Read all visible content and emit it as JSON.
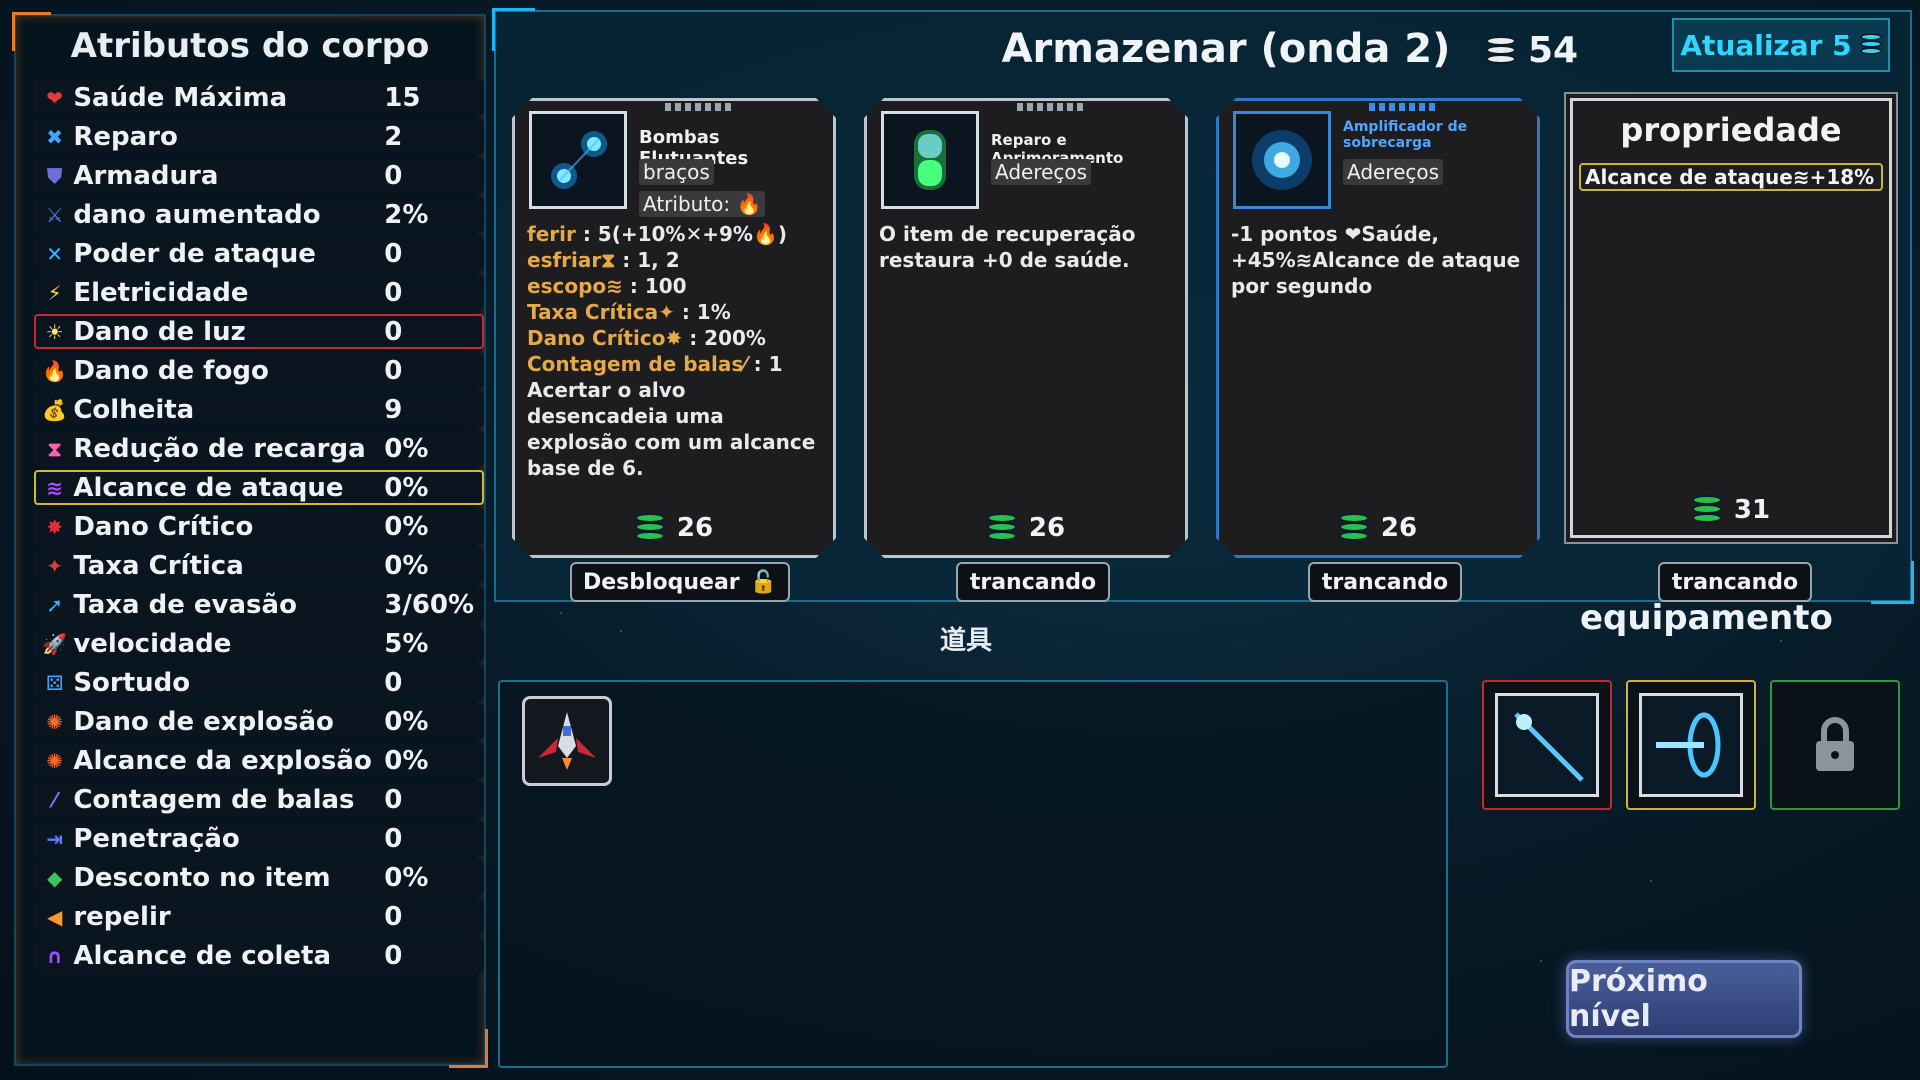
{
  "attributes": {
    "title": "Atributos do corpo",
    "rows": [
      {
        "icon": "heart-icon",
        "glyph": "❤",
        "color": "#e5383b",
        "label": "Saúde Máxima",
        "value": "15"
      },
      {
        "icon": "wrench-icon",
        "glyph": "✖",
        "color": "#3fa7ff",
        "label": "Reparo",
        "value": "2"
      },
      {
        "icon": "shield-icon",
        "glyph": "⛊",
        "color": "#6b6fd6",
        "label": "Armadura",
        "value": "0"
      },
      {
        "icon": "sword-icon",
        "glyph": "⚔",
        "color": "#4a7de0",
        "label": "dano aumentado",
        "value": "2%"
      },
      {
        "icon": "crossed-swords-icon",
        "glyph": "✕",
        "color": "#2fb9ff",
        "label": "Poder de ataque",
        "value": "0"
      },
      {
        "icon": "lightning-icon",
        "glyph": "⚡",
        "color": "#ffd93a",
        "label": "Eletricidade",
        "value": "0"
      },
      {
        "icon": "sun-icon",
        "glyph": "☀",
        "color": "#ffe36a",
        "label": "Dano de luz",
        "value": "0"
      },
      {
        "icon": "fire-icon",
        "glyph": "🔥",
        "color": "#ff8a2a",
        "label": "Dano de fogo",
        "value": "0"
      },
      {
        "icon": "money-bag-icon",
        "glyph": "💰",
        "color": "#4fbf57",
        "label": "Colheita",
        "value": "9"
      },
      {
        "icon": "hourglass-icon",
        "glyph": "⧗",
        "color": "#ff5fb0",
        "label": "Redução de recarga",
        "value": "0%"
      },
      {
        "icon": "wifi-range-icon",
        "glyph": "≋",
        "color": "#b04bff",
        "label": "Alcance de ataque",
        "value": "0%"
      },
      {
        "icon": "critical-damage-icon",
        "glyph": "✸",
        "color": "#e52d36",
        "label": "Dano Crítico",
        "value": "0%"
      },
      {
        "icon": "critical-rate-icon",
        "glyph": "✦",
        "color": "#e5383b",
        "label": "Taxa Crítica",
        "value": "0%"
      },
      {
        "icon": "running-man-icon",
        "glyph": "➚",
        "color": "#36b0ff",
        "label": "Taxa de evasão",
        "value": "3/60%"
      },
      {
        "icon": "rocket-icon",
        "glyph": "🚀",
        "color": "#ff4848",
        "label": "velocidade",
        "value": "5%"
      },
      {
        "icon": "dice-icon",
        "glyph": "⚄",
        "color": "#3aa4ff",
        "label": "Sortudo",
        "value": "0"
      },
      {
        "icon": "explosion-icon",
        "glyph": "✺",
        "color": "#ff6a2a",
        "label": "Dano de explosão",
        "value": "0%"
      },
      {
        "icon": "explosion-range-icon",
        "glyph": "✺",
        "color": "#ff6a2a",
        "label": "Alcance da explosão",
        "value": "0%"
      },
      {
        "icon": "bullet-icon",
        "glyph": "⁄",
        "color": "#8a6cff",
        "label": "Contagem de balas",
        "value": "0"
      },
      {
        "icon": "penetration-icon",
        "glyph": "⇥",
        "color": "#5d7cff",
        "label": "Penetração",
        "value": "0"
      },
      {
        "icon": "tag-icon",
        "glyph": "◆",
        "color": "#3dc35e",
        "label": "Desconto no item",
        "value": "0%"
      },
      {
        "icon": "repel-icon",
        "glyph": "◀",
        "color": "#ff9a2a",
        "label": "repelir",
        "value": "0"
      },
      {
        "icon": "magnet-icon",
        "glyph": "∩",
        "color": "#9b4dff",
        "label": "Alcance de coleta",
        "value": "0"
      }
    ]
  },
  "shop": {
    "title": "Armazenar (onda 2)",
    "coins": "54",
    "refresh_label": "Atualizar 5",
    "cards": [
      {
        "name": "Bombas Flutuantes",
        "tag1": "braços",
        "tag2": "Atributo:",
        "stats": [
          {
            "k": "ferir",
            "v": ": 5(+10%✕+9%🔥)"
          },
          {
            "k": "esfriar⧗",
            "v": ": 1, 2"
          },
          {
            "k": "escopo≋",
            "v": ": 100"
          },
          {
            "k": "Taxa Crítica✦",
            "v": ": 1%"
          },
          {
            "k": "Dano Crítico✸",
            "v": ": 200%"
          },
          {
            "k": "Contagem de balas⁄",
            "v": ": 1"
          }
        ],
        "text": "Acertar o alvo desencadeia uma explosão com um alcance base de 6.",
        "price": "26",
        "button": "Desbloquear"
      },
      {
        "name": "Reparo e Aprimoramento",
        "tag1": "Adereços",
        "text": "O item de recuperação restaura +0 de saúde.",
        "price": "26",
        "button": "trancando"
      },
      {
        "name": "Amplificador de sobrecarga",
        "tag1": "Adereços",
        "text": "-1 pontos ❤Saúde, +45%≋Alcance de ataque por segundo",
        "price": "26",
        "button": "trancando"
      }
    ],
    "property_card": {
      "title": "propriedade",
      "chip": "Alcance de ataque≋+18%",
      "price": "31",
      "button": "trancando"
    }
  },
  "items": {
    "label": "道具"
  },
  "equipment": {
    "label": "equipamento"
  },
  "next_level_label": "Próximo nível"
}
